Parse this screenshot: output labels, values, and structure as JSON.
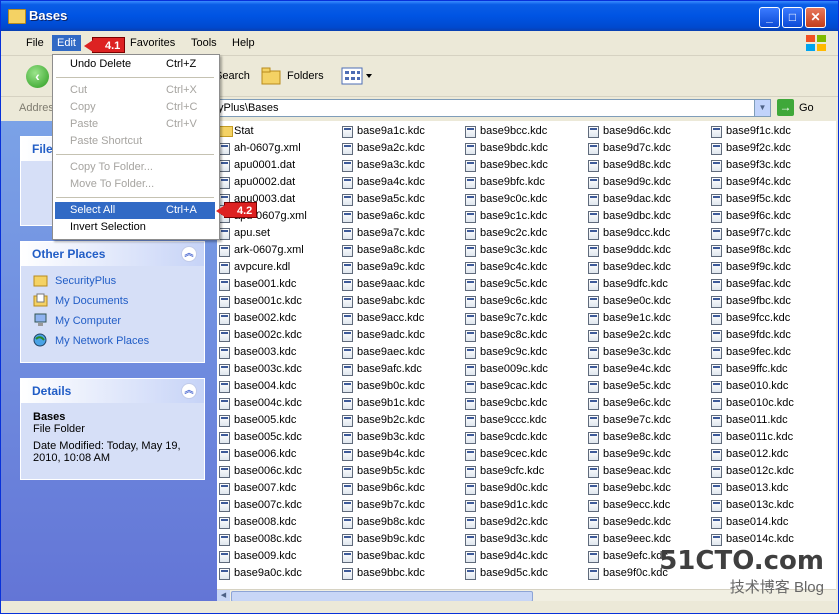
{
  "window": {
    "title": "Bases"
  },
  "titlebar_buttons": [
    "_",
    "□",
    "✕"
  ],
  "menubar": [
    "File",
    "Edit",
    "Favorites",
    "Tools",
    "Help"
  ],
  "toolbar": {
    "search_label": "Search",
    "folders_label": "Folders"
  },
  "address": {
    "label": "Address",
    "value": "yPlus\\Bases",
    "go_label": "Go"
  },
  "edit_menu": {
    "items": [
      {
        "label": "Undo Delete",
        "accel": "Ctrl+Z",
        "disabled": false
      },
      {
        "label": "Cut",
        "accel": "Ctrl+X",
        "disabled": true
      },
      {
        "label": "Copy",
        "accel": "Ctrl+C",
        "disabled": true
      },
      {
        "label": "Paste",
        "accel": "Ctrl+V",
        "disabled": true
      },
      {
        "label": "Paste Shortcut",
        "accel": "",
        "disabled": true
      },
      {
        "label": "Copy To Folder...",
        "accel": "",
        "disabled": true
      },
      {
        "label": "Move To Folder...",
        "accel": "",
        "disabled": true
      },
      {
        "label": "Select All",
        "accel": "Ctrl+A",
        "disabled": false,
        "highlighted": true
      },
      {
        "label": "Invert Selection",
        "accel": "",
        "disabled": false
      }
    ]
  },
  "markers": {
    "menu": "4.1",
    "select_all": "4.2"
  },
  "sidebar": {
    "file_tasks_title": "File",
    "other_places": {
      "title": "Other Places",
      "items": [
        "SecurityPlus",
        "My Documents",
        "My Computer",
        "My Network Places"
      ]
    },
    "details": {
      "title": "Details",
      "name": "Bases",
      "type": "File Folder",
      "modified": "Date Modified: Today, May 19, 2010, 10:08 AM"
    }
  },
  "files": {
    "col1": [
      "Stat",
      "ah-0607g.xml",
      "apu0001.dat",
      "apu0002.dat",
      "apu0003.dat",
      "apu-0607g.xml",
      "apu.set",
      "ark-0607g.xml",
      "avpcure.kdl",
      "base001.kdc",
      "base001c.kdc",
      "base002.kdc",
      "base002c.kdc",
      "base003.kdc",
      "base003c.kdc",
      "base004.kdc",
      "base004c.kdc",
      "base005.kdc",
      "base005c.kdc",
      "base006.kdc",
      "base006c.kdc",
      "base007.kdc",
      "base007c.kdc",
      "base008.kdc",
      "base008c.kdc",
      "base009.kdc",
      "base9a0c.kdc"
    ],
    "col2": [
      "base9a1c.kdc",
      "base9a2c.kdc",
      "base9a3c.kdc",
      "base9a4c.kdc",
      "base9a5c.kdc",
      "base9a6c.kdc",
      "base9a7c.kdc",
      "base9a8c.kdc",
      "base9a9c.kdc",
      "base9aac.kdc",
      "base9abc.kdc",
      "base9acc.kdc",
      "base9adc.kdc",
      "base9aec.kdc",
      "base9afc.kdc",
      "base9b0c.kdc",
      "base9b1c.kdc",
      "base9b2c.kdc",
      "base9b3c.kdc",
      "base9b4c.kdc",
      "base9b5c.kdc",
      "base9b6c.kdc",
      "base9b7c.kdc",
      "base9b8c.kdc",
      "base9b9c.kdc",
      "base9bac.kdc",
      "base9bbc.kdc"
    ],
    "col3": [
      "base9bcc.kdc",
      "base9bdc.kdc",
      "base9bec.kdc",
      "base9bfc.kdc",
      "base9c0c.kdc",
      "base9c1c.kdc",
      "base9c2c.kdc",
      "base9c3c.kdc",
      "base9c4c.kdc",
      "base9c5c.kdc",
      "base9c6c.kdc",
      "base9c7c.kdc",
      "base9c8c.kdc",
      "base9c9c.kdc",
      "base009c.kdc",
      "base9cac.kdc",
      "base9cbc.kdc",
      "base9ccc.kdc",
      "base9cdc.kdc",
      "base9cec.kdc",
      "base9cfc.kdc",
      "base9d0c.kdc",
      "base9d1c.kdc",
      "base9d2c.kdc",
      "base9d3c.kdc",
      "base9d4c.kdc",
      "base9d5c.kdc"
    ],
    "col4": [
      "base9d6c.kdc",
      "base9d7c.kdc",
      "base9d8c.kdc",
      "base9d9c.kdc",
      "base9dac.kdc",
      "base9dbc.kdc",
      "base9dcc.kdc",
      "base9ddc.kdc",
      "base9dec.kdc",
      "base9dfc.kdc",
      "base9e0c.kdc",
      "base9e1c.kdc",
      "base9e2c.kdc",
      "base9e3c.kdc",
      "base9e4c.kdc",
      "base9e5c.kdc",
      "base9e6c.kdc",
      "base9e7c.kdc",
      "base9e8c.kdc",
      "base9e9c.kdc",
      "base9eac.kdc",
      "base9ebc.kdc",
      "base9ecc.kdc",
      "base9edc.kdc",
      "base9eec.kdc",
      "base9efc.kdc",
      "base9f0c.kdc"
    ],
    "col5": [
      "base9f1c.kdc",
      "base9f2c.kdc",
      "base9f3c.kdc",
      "base9f4c.kdc",
      "base9f5c.kdc",
      "base9f6c.kdc",
      "base9f7c.kdc",
      "base9f8c.kdc",
      "base9f9c.kdc",
      "base9fac.kdc",
      "base9fbc.kdc",
      "base9fcc.kdc",
      "base9fdc.kdc",
      "base9fec.kdc",
      "base9ffc.kdc",
      "base010.kdc",
      "base010c.kdc",
      "base011.kdc",
      "base011c.kdc",
      "base012.kdc",
      "base012c.kdc",
      "base013.kdc",
      "base013c.kdc",
      "base014.kdc",
      "base014c.kdc",
      "",
      ""
    ]
  },
  "watermark": {
    "top": "51CTO.com",
    "bottom": "技术博客  Blog"
  }
}
